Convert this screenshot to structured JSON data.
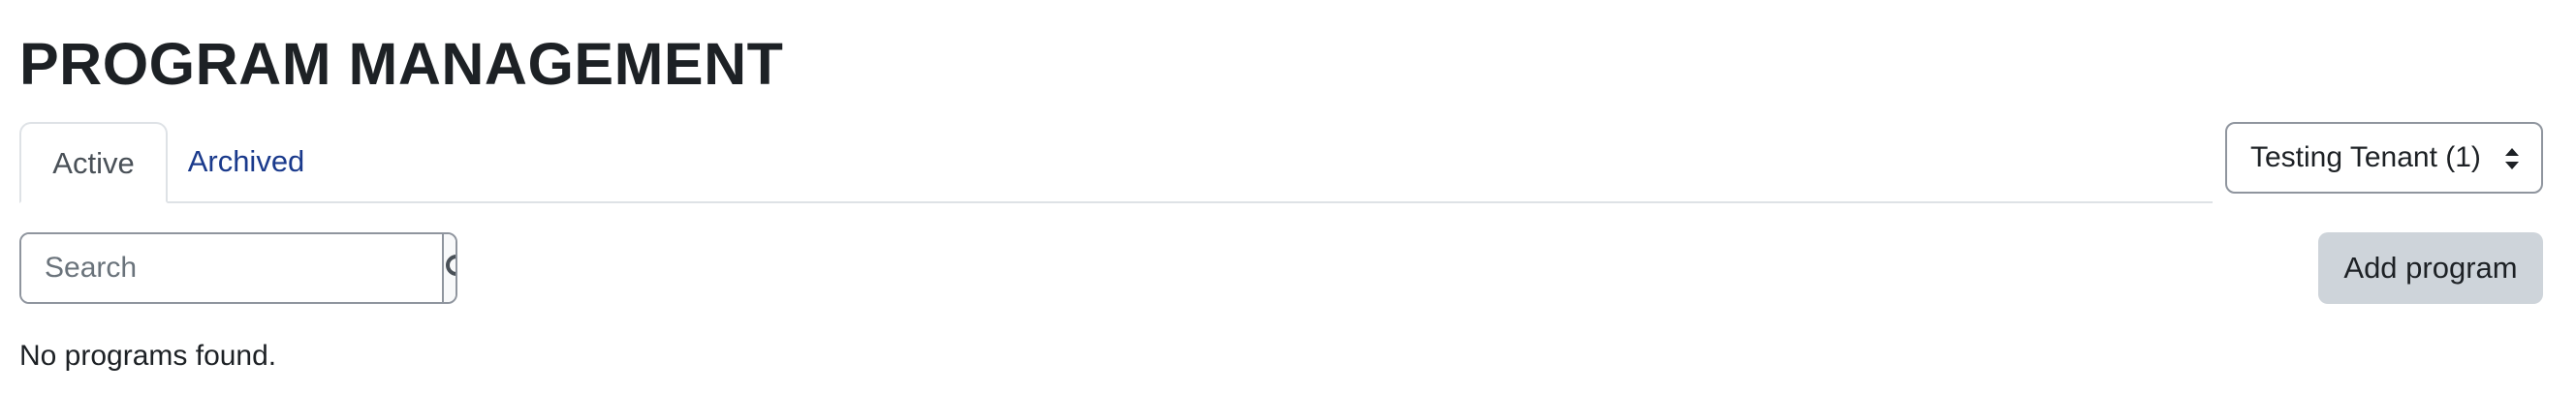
{
  "page": {
    "title": "PROGRAM MANAGEMENT"
  },
  "tabs": [
    {
      "label": "Active",
      "active": true
    },
    {
      "label": "Archived",
      "active": false
    }
  ],
  "tenant_select": {
    "selected": "Testing Tenant (1)"
  },
  "search": {
    "placeholder": "Search",
    "value": "",
    "icon": "search-icon"
  },
  "actions": {
    "add_label": "Add program"
  },
  "results": {
    "empty_message": "No programs found."
  },
  "colors": {
    "text": "#1d2125",
    "link": "#1a3a8c",
    "border": "#8f959e",
    "tab_border": "#dee2e6",
    "button_bg": "#ced4da"
  }
}
